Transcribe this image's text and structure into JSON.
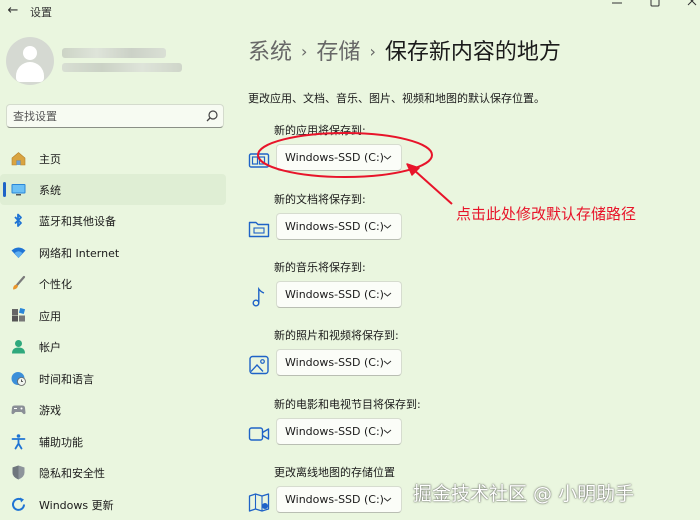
{
  "window": {
    "title": "设置",
    "back_icon": "arrow-left-icon",
    "controls": [
      "minimize-icon",
      "maximize-icon",
      "close-icon"
    ]
  },
  "account": {
    "avatar_icon": "user-avatar-icon"
  },
  "search": {
    "placeholder": "查找设置",
    "icon": "search-icon"
  },
  "sidebar": {
    "items": [
      {
        "label": "主页",
        "icon": "home-icon",
        "active": false
      },
      {
        "label": "系统",
        "icon": "system-icon",
        "active": true
      },
      {
        "label": "蓝牙和其他设备",
        "icon": "bluetooth-icon",
        "active": false
      },
      {
        "label": "网络和 Internet",
        "icon": "wifi-icon",
        "active": false
      },
      {
        "label": "个性化",
        "icon": "brush-icon",
        "active": false
      },
      {
        "label": "应用",
        "icon": "apps-icon",
        "active": false
      },
      {
        "label": "帐户",
        "icon": "account-icon",
        "active": false
      },
      {
        "label": "时间和语言",
        "icon": "globe-clock-icon",
        "active": false
      },
      {
        "label": "游戏",
        "icon": "gamepad-icon",
        "active": false
      },
      {
        "label": "辅助功能",
        "icon": "accessibility-icon",
        "active": false
      },
      {
        "label": "隐私和安全性",
        "icon": "shield-icon",
        "active": false
      },
      {
        "label": "Windows 更新",
        "icon": "windows-update-icon",
        "active": false
      }
    ]
  },
  "breadcrumb": {
    "items": [
      "系统",
      "存储",
      "保存新内容的地方"
    ],
    "separator": "›"
  },
  "page": {
    "description": "更改应用、文档、音乐、图片、视频和地图的默认保存位置。",
    "sections": [
      {
        "label": "新的应用将保存到:",
        "icon": "apps-save-icon",
        "value": "Windows-SSD (C:)"
      },
      {
        "label": "新的文档将保存到:",
        "icon": "folder-icon",
        "value": "Windows-SSD (C:)"
      },
      {
        "label": "新的音乐将保存到:",
        "icon": "music-note-icon",
        "value": "Windows-SSD (C:)"
      },
      {
        "label": "新的照片和视频将保存到:",
        "icon": "photo-icon",
        "value": "Windows-SSD (C:)"
      },
      {
        "label": "新的电影和电视节目将保存到:",
        "icon": "video-camera-icon",
        "value": "Windows-SSD (C:)"
      },
      {
        "label": "更改离线地图的存储位置",
        "icon": "map-icon",
        "value": "Windows-SSD (C:)"
      }
    ]
  },
  "annotation": {
    "text": "点击此处修改默认存储路径",
    "color": "#e8142a"
  },
  "watermark": {
    "text": "掘金技术社区 @ 小明助手"
  },
  "colors": {
    "background": "#eaf6df",
    "accent": "#1f63c7",
    "active_item": "#dfeed4"
  }
}
